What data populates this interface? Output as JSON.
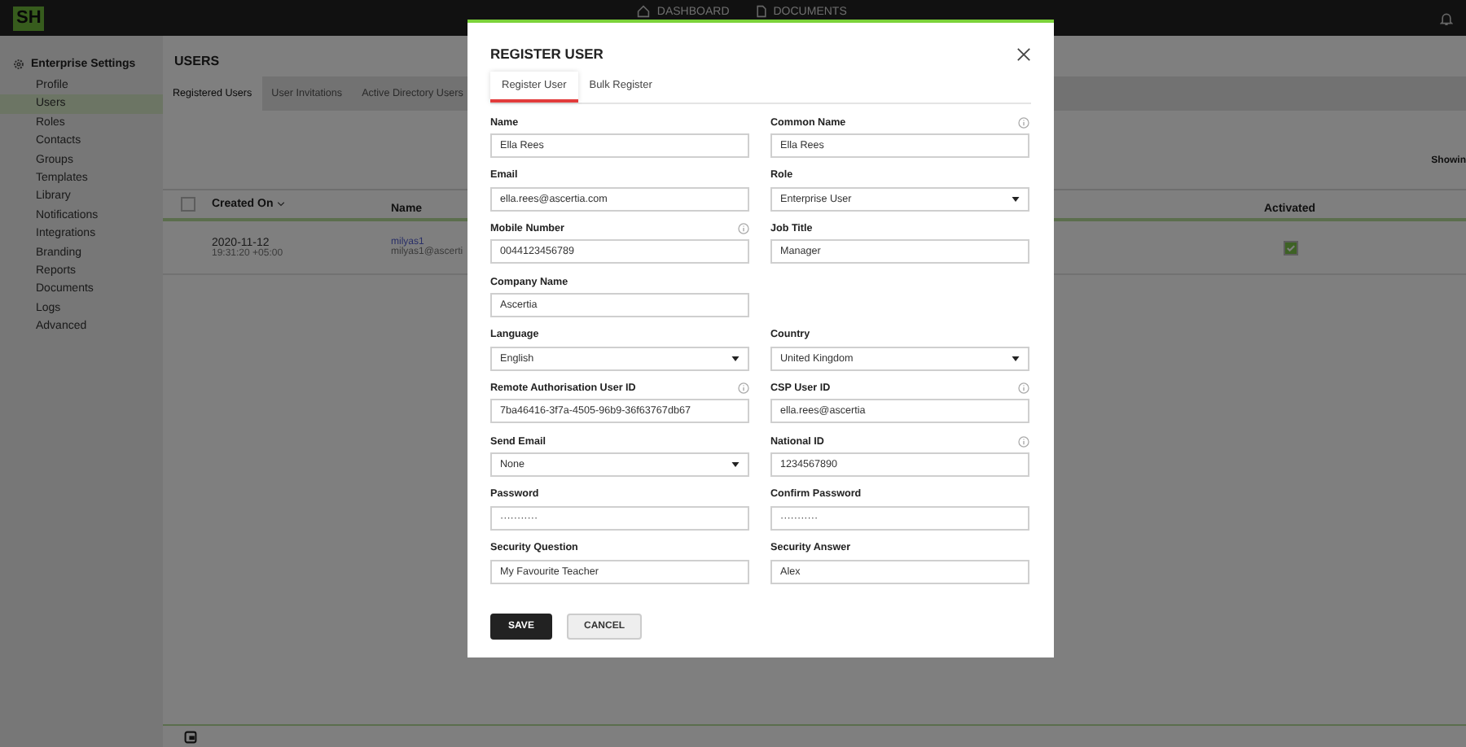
{
  "topbar": {
    "logo": "SH",
    "nav": [
      {
        "label": "DASHBOARD",
        "kind": "home"
      },
      {
        "label": "DOCUMENTS",
        "kind": "document"
      }
    ]
  },
  "sidebar": {
    "title": "Enterprise Settings",
    "items": [
      {
        "label": "Profile",
        "selected": false
      },
      {
        "label": "Users",
        "selected": true
      },
      {
        "label": "Roles",
        "selected": false
      },
      {
        "label": "Contacts",
        "selected": false
      },
      {
        "label": "Groups",
        "selected": false
      },
      {
        "label": "Templates",
        "selected": false
      },
      {
        "label": "Library",
        "selected": false
      },
      {
        "label": "Notifications",
        "selected": false
      },
      {
        "label": "Integrations",
        "selected": false
      },
      {
        "label": "Branding",
        "selected": false
      },
      {
        "label": "Reports",
        "selected": false
      },
      {
        "label": "Documents",
        "selected": false
      },
      {
        "label": "Logs",
        "selected": false
      },
      {
        "label": "Advanced",
        "selected": false
      }
    ]
  },
  "main": {
    "title": "USERS",
    "tabs": [
      {
        "label": "Registered Users",
        "selected": true
      },
      {
        "label": "User Invitations",
        "selected": false
      },
      {
        "label": "Active Directory Users",
        "selected": false
      }
    ],
    "showing": "Showin",
    "table": {
      "all_selected": false,
      "columns": [
        "Created On",
        "Name",
        "Activated"
      ],
      "rows": [
        {
          "date": "2020-11-12",
          "time": "19:31:20 +05:00",
          "name": "milyas1",
          "email": "milyas1@ascerti",
          "activated": true
        }
      ]
    }
  },
  "modal": {
    "title": "REGISTER USER",
    "tabs": [
      {
        "label": "Register User",
        "selected": true
      },
      {
        "label": "Bulk Register",
        "selected": false
      }
    ],
    "rows": [
      [
        {
          "label": "Name",
          "kind": "text",
          "value": "Ella Rees",
          "info": false
        },
        {
          "label": "Common Name",
          "kind": "text",
          "value": "Ella Rees",
          "info": true
        }
      ],
      [
        {
          "label": "Email",
          "kind": "text",
          "value": "ella.rees@ascertia.com",
          "info": false
        },
        {
          "label": "Role",
          "kind": "select",
          "value": "Enterprise User",
          "info": false
        }
      ],
      [
        {
          "label": "Mobile Number",
          "kind": "text",
          "value": "0044123456789",
          "info": true
        },
        {
          "label": "Job Title",
          "kind": "text",
          "value": "Manager",
          "info": false
        }
      ],
      [
        {
          "label": "Company Name",
          "kind": "text",
          "value": "Ascertia",
          "info": false
        }
      ],
      [
        {
          "label": "Language",
          "kind": "select",
          "value": "English",
          "info": false
        },
        {
          "label": "Country",
          "kind": "select",
          "value": "United Kingdom",
          "info": false
        }
      ],
      [
        {
          "label": "Remote Authorisation User ID",
          "kind": "text",
          "value": "7ba46416-3f7a-4505-96b9-36f63767db67",
          "info": true
        },
        {
          "label": "CSP User ID",
          "kind": "text",
          "value": "ella.rees@ascertia",
          "info": true
        }
      ],
      [
        {
          "label": "Send Email",
          "kind": "select",
          "value": "None",
          "info": false
        },
        {
          "label": "National ID",
          "kind": "text",
          "value": "1234567890",
          "info": true
        }
      ],
      [
        {
          "label": "Password",
          "kind": "password",
          "value": "···········",
          "info": false
        },
        {
          "label": "Confirm Password",
          "kind": "password",
          "value": "···········",
          "info": false
        }
      ],
      [
        {
          "label": "Security Question",
          "kind": "text",
          "value": "My Favourite Teacher",
          "info": false
        },
        {
          "label": "Security Answer",
          "kind": "text",
          "value": "Alex",
          "info": false
        }
      ]
    ],
    "buttons": [
      {
        "label": "SAVE",
        "kind": "primary"
      },
      {
        "label": "CANCEL",
        "kind": "secondary"
      }
    ]
  }
}
